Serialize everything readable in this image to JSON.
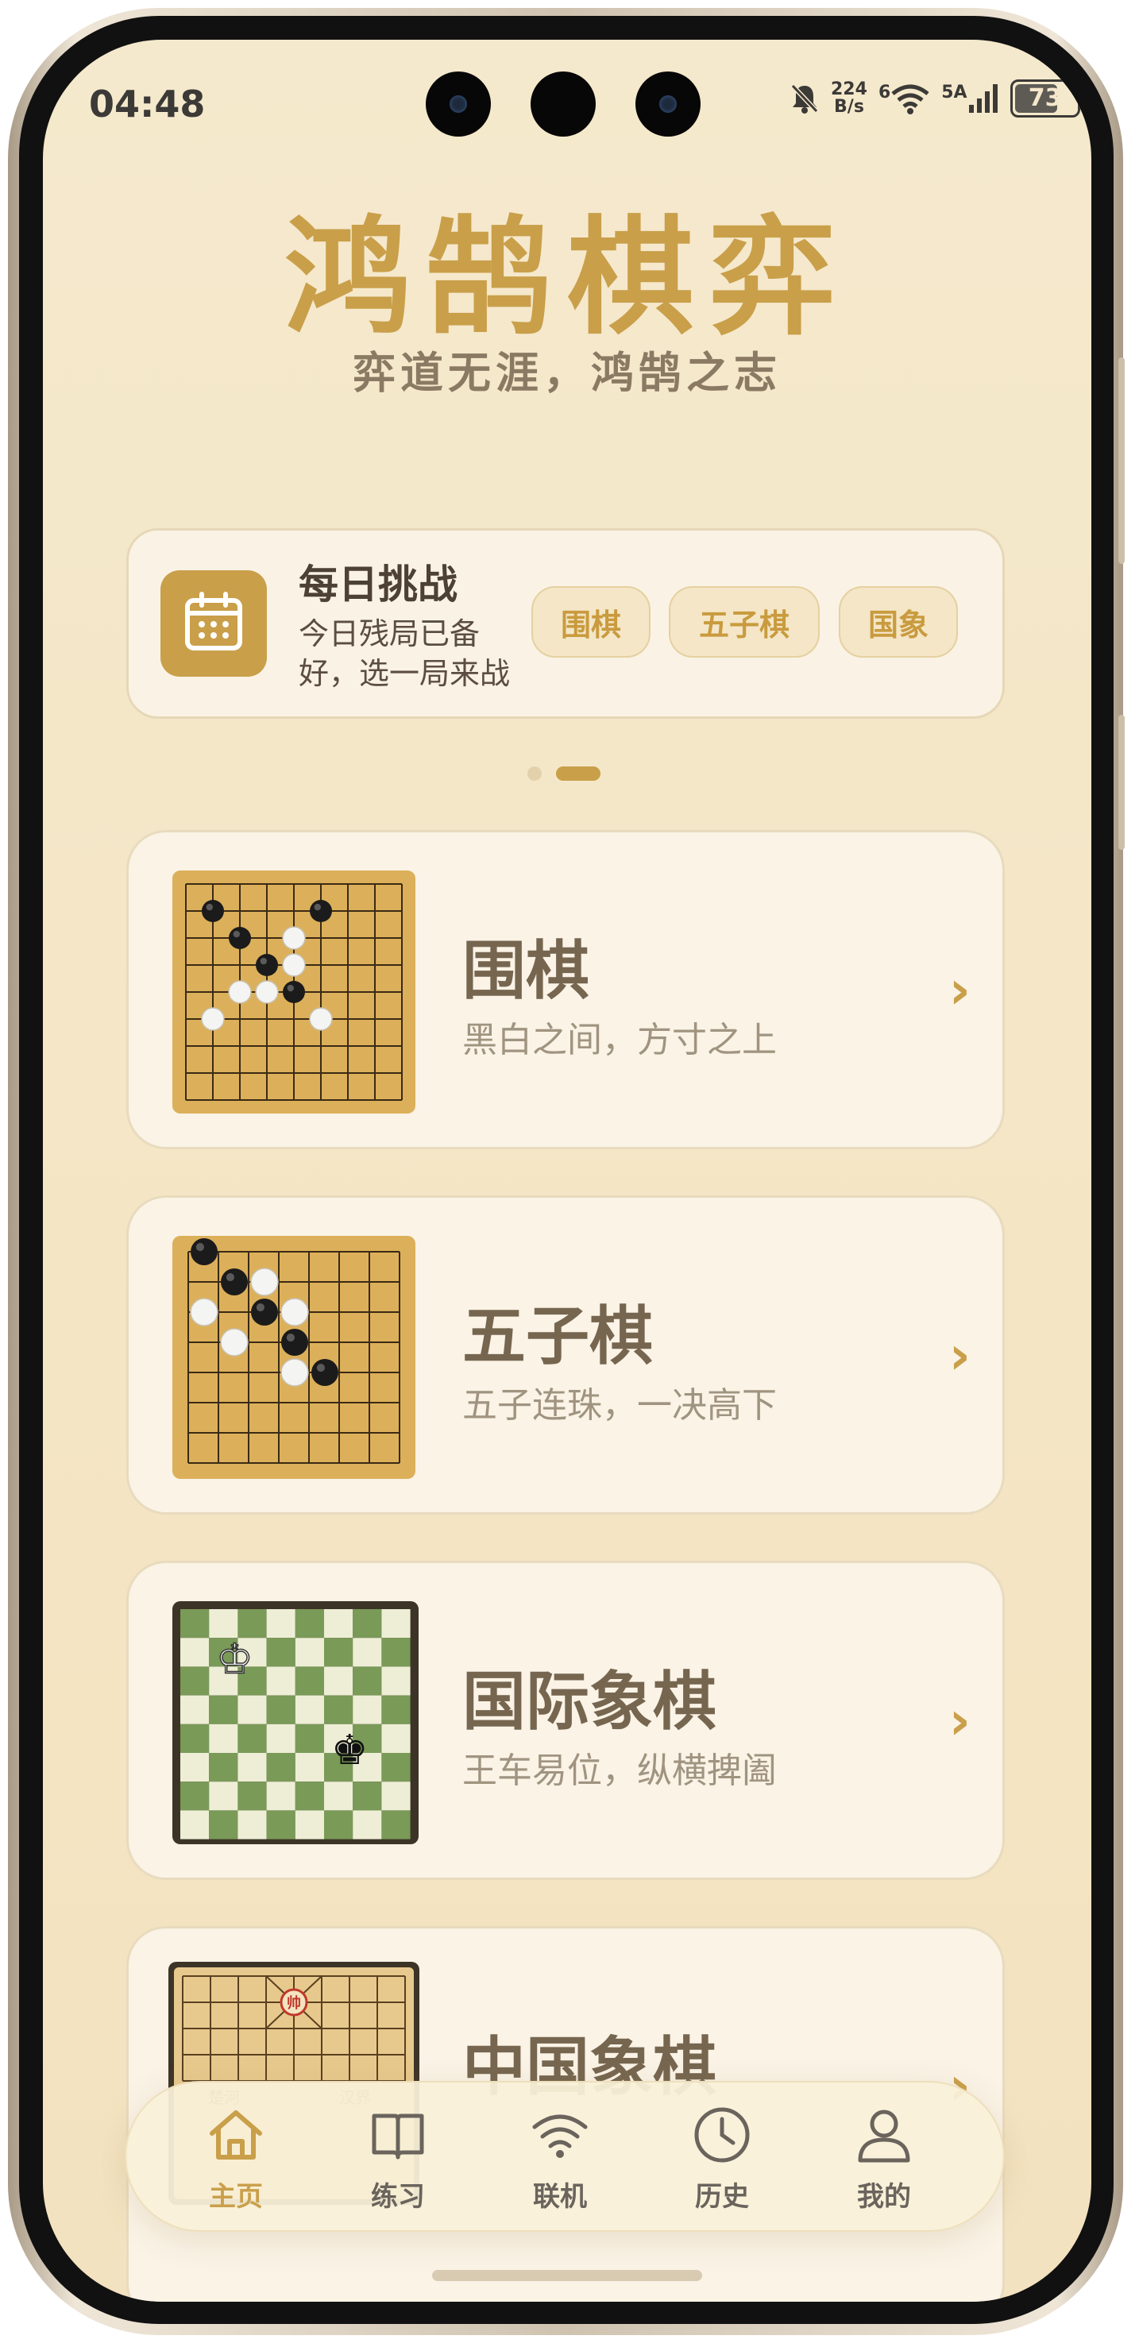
{
  "status_bar": {
    "time": "04:48",
    "speed": "224",
    "speed_unit": "B/s",
    "wifi_label": "6",
    "network": "5A",
    "battery": "73"
  },
  "app": {
    "title": "鸿鹄棋弈",
    "subtitle": "弈道无涯，鸿鹄之志"
  },
  "daily": {
    "icon": "calendar-icon",
    "title": "每日挑战",
    "desc": "今日残局已备好，选一局来战",
    "chips": [
      "围棋",
      "五子棋",
      "国象"
    ]
  },
  "carousel": {
    "count": 2,
    "active": 1
  },
  "games": [
    {
      "title": "围棋",
      "desc": "黑白之间，方寸之上",
      "thumb": "go-board-icon"
    },
    {
      "title": "五子棋",
      "desc": "五子连珠，一决高下",
      "thumb": "gomoku-board-icon"
    },
    {
      "title": "国际象棋",
      "desc": "王车易位，纵横捭阖",
      "thumb": "chess-board-icon"
    },
    {
      "title": "中国象棋",
      "desc": "",
      "thumb": "xiangqi-board-icon",
      "board_text": [
        "帅",
        "楚河",
        "汉界"
      ]
    }
  ],
  "nav": [
    {
      "label": "主页",
      "icon": "home-icon",
      "active": true
    },
    {
      "label": "练习",
      "icon": "book-icon",
      "active": false
    },
    {
      "label": "联机",
      "icon": "wifi-icon",
      "active": false
    },
    {
      "label": "历史",
      "icon": "clock-icon",
      "active": false
    },
    {
      "label": "我的",
      "icon": "person-icon",
      "active": false
    }
  ],
  "colors": {
    "accent": "#c99f4a",
    "background": "#f5e8c9",
    "card": "#faf3e6",
    "text_dark": "#766650"
  }
}
